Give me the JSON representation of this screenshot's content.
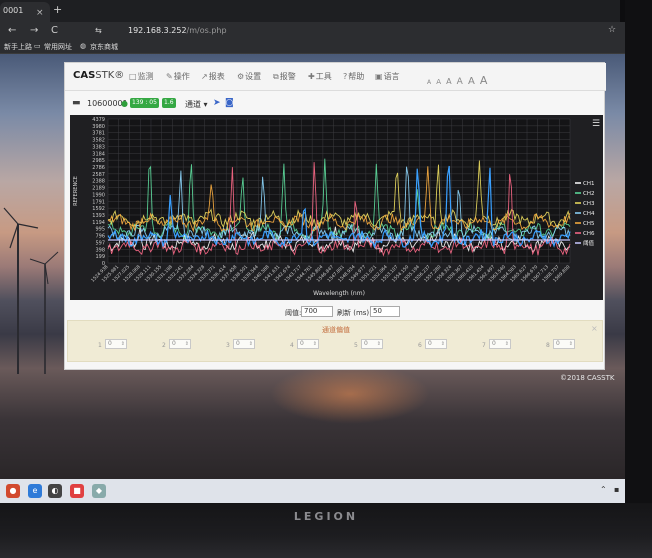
{
  "browser": {
    "tab_title": "0001",
    "tab_close": "×",
    "new_tab": "+",
    "back": "←",
    "forward": "→",
    "reload": "C",
    "url_host": "192.168.3.252",
    "url_path": "/m/os.php",
    "star": "☆",
    "bookmarks": [
      "新手上路",
      "常用网址",
      "京东商城"
    ]
  },
  "app": {
    "brand_cas": "CAS",
    "brand_stk": "STK®",
    "nav": [
      {
        "icon": "□",
        "label": "监测"
      },
      {
        "icon": "✎",
        "label": "操作"
      },
      {
        "icon": "↗",
        "label": "报表"
      },
      {
        "icon": "⚙",
        "label": "设置"
      },
      {
        "icon": "⧉",
        "label": "报警"
      },
      {
        "icon": "✚",
        "label": "工具"
      },
      {
        "icon": "?",
        "label": "帮助"
      },
      {
        "icon": "▣",
        "label": "语言"
      }
    ],
    "font_sizes": [
      "A",
      "A",
      "A",
      "A",
      "A",
      "A"
    ],
    "device_id": "10600001",
    "badge1": "139 : 05",
    "badge2": "1.6",
    "channel_select": "通道 ▾",
    "threshold_label": "阈值:",
    "threshold_value": "700",
    "refresh_label": "刷新 (ms):",
    "refresh_value": "50",
    "offset_title": "通道偏值",
    "offset_close": "×",
    "offsets": [
      {
        "label": "1",
        "value": "0"
      },
      {
        "label": "2",
        "value": "0"
      },
      {
        "label": "3",
        "value": "0"
      },
      {
        "label": "4",
        "value": "0"
      },
      {
        "label": "5",
        "value": "0"
      },
      {
        "label": "6",
        "value": "0"
      },
      {
        "label": "7",
        "value": "0"
      },
      {
        "label": "8",
        "value": "0"
      }
    ],
    "copyright": "©2018 CASSTK"
  },
  "colors": {
    "ch1": "#ffffff",
    "ch2": "#5fe0a0",
    "ch3": "#f0e060",
    "ch4": "#8ed8ff",
    "ch5": "#ffb040",
    "ch6": "#ff6a8a",
    "threshold": "#c8c8ff",
    "blue_line": "#3aa0ff",
    "badge_green": "#35a843"
  },
  "chart_data": {
    "type": "line",
    "xlabel": "Wavelength (nm)",
    "ylabel": "REFERENCE",
    "y_ticks": [
      "4379",
      "3980",
      "3781",
      "3582",
      "3383",
      "3184",
      "2985",
      "2786",
      "2587",
      "2388",
      "2189",
      "1990",
      "1791",
      "1592",
      "1393",
      "1194",
      "995",
      "796",
      "597",
      "398",
      "199",
      "0"
    ],
    "ylim": [
      0,
      4379
    ],
    "x_tick_count": 44,
    "x_range_nm": [
      1524.938,
      1569.8
    ],
    "legend": [
      "CH1",
      "CH2",
      "CH3",
      "CH4",
      "CH5",
      "CH6",
      "阈值"
    ],
    "legend_position": "right",
    "threshold": 700,
    "grid": true,
    "series": [
      {
        "name": "CH1",
        "baseline": 620,
        "peaks": [
          [
            1528,
            1200
          ],
          [
            1539,
            1100
          ],
          [
            1547,
            900
          ],
          [
            1557,
            1100
          ],
          [
            1563,
            800
          ]
        ]
      },
      {
        "name": "CH2",
        "baseline": 1000,
        "peaks": [
          [
            1529,
            3300
          ],
          [
            1533,
            3100
          ],
          [
            1538,
            3000
          ],
          [
            1542,
            3200
          ],
          [
            1546,
            3000
          ],
          [
            1551,
            3000
          ],
          [
            1555,
            2200
          ]
        ]
      },
      {
        "name": "CH3",
        "baseline": 1350,
        "peaks": [
          [
            1553,
            3000
          ],
          [
            1557,
            3000
          ],
          [
            1561,
            3000
          ]
        ]
      },
      {
        "name": "CH4",
        "baseline": 900,
        "peaks": [
          [
            1532,
            3000
          ],
          [
            1540,
            2800
          ],
          [
            1554,
            3100
          ],
          [
            1559,
            2700
          ]
        ]
      },
      {
        "name": "CH5",
        "baseline": 1250,
        "peaks": [
          [
            1535,
            2500
          ],
          [
            1556,
            3000
          ]
        ]
      },
      {
        "name": "CH6",
        "baseline": 500,
        "peaks": [
          [
            1537,
            3100
          ],
          [
            1545,
            3100
          ],
          [
            1549,
            2200
          ],
          [
            1564,
            3000
          ]
        ]
      }
    ],
    "blue_series": {
      "baseline": 760,
      "peaks": [
        [
          1531,
          2000
        ],
        [
          1544,
          1800
        ],
        [
          1555,
          3000
        ],
        [
          1558,
          3300
        ],
        [
          1562,
          3100
        ]
      ]
    }
  }
}
